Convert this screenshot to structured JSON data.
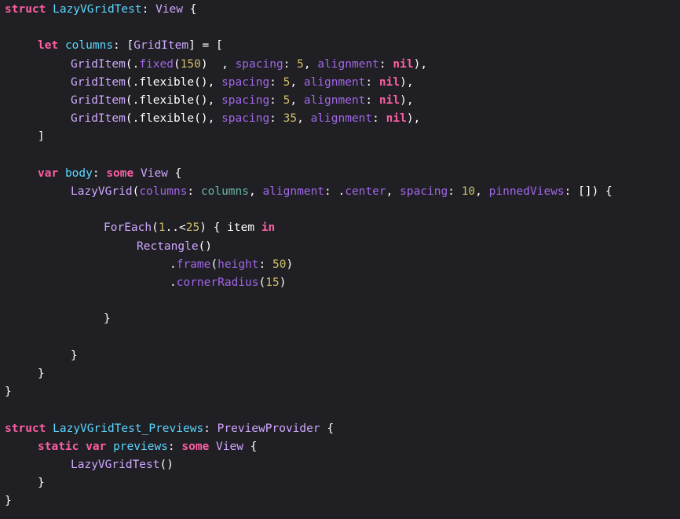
{
  "editor": {
    "language": "Swift",
    "theme": "dark",
    "background": "#1f1f24",
    "colors": {
      "keyword": "#fc5fa3",
      "type_declaration": "#5dd8ff",
      "type_name": "#d0a8ff",
      "property": "#a167e6",
      "number": "#d0bf69",
      "plain": "#ffffff",
      "column_ref": "#67b7a4"
    },
    "lines": [
      {
        "indent": 0,
        "tokens": [
          {
            "t": "struct",
            "c": "kw"
          },
          {
            "t": " ",
            "c": "plain"
          },
          {
            "t": "LazyVGridTest",
            "c": "typedecl"
          },
          {
            "t": ": ",
            "c": "plain"
          },
          {
            "t": "View",
            "c": "typename"
          },
          {
            "t": " {",
            "c": "plain"
          }
        ]
      },
      {
        "indent": 0,
        "tokens": []
      },
      {
        "indent": 1,
        "tokens": [
          {
            "t": "let",
            "c": "kw"
          },
          {
            "t": " ",
            "c": "plain"
          },
          {
            "t": "columns",
            "c": "typedecl"
          },
          {
            "t": ": [",
            "c": "plain"
          },
          {
            "t": "GridItem",
            "c": "typename"
          },
          {
            "t": "] = [",
            "c": "plain"
          }
        ]
      },
      {
        "indent": 2,
        "tokens": [
          {
            "t": "GridItem",
            "c": "typename"
          },
          {
            "t": "(.",
            "c": "plain"
          },
          {
            "t": "fixed",
            "c": "prop"
          },
          {
            "t": "(",
            "c": "plain"
          },
          {
            "t": "150",
            "c": "num"
          },
          {
            "t": ")  , ",
            "c": "plain"
          },
          {
            "t": "spacing",
            "c": "prop"
          },
          {
            "t": ": ",
            "c": "plain"
          },
          {
            "t": "5",
            "c": "num"
          },
          {
            "t": ", ",
            "c": "plain"
          },
          {
            "t": "alignment",
            "c": "prop"
          },
          {
            "t": ": ",
            "c": "plain"
          },
          {
            "t": "nil",
            "c": "kw"
          },
          {
            "t": "),",
            "c": "plain"
          }
        ]
      },
      {
        "indent": 2,
        "tokens": [
          {
            "t": "GridItem",
            "c": "typename"
          },
          {
            "t": "(.flexible(), ",
            "c": "plain"
          },
          {
            "t": "spacing",
            "c": "prop"
          },
          {
            "t": ": ",
            "c": "plain"
          },
          {
            "t": "5",
            "c": "num"
          },
          {
            "t": ", ",
            "c": "plain"
          },
          {
            "t": "alignment",
            "c": "prop"
          },
          {
            "t": ": ",
            "c": "plain"
          },
          {
            "t": "nil",
            "c": "kw"
          },
          {
            "t": "),",
            "c": "plain"
          }
        ]
      },
      {
        "indent": 2,
        "tokens": [
          {
            "t": "GridItem",
            "c": "typename"
          },
          {
            "t": "(.flexible(), ",
            "c": "plain"
          },
          {
            "t": "spacing",
            "c": "prop"
          },
          {
            "t": ": ",
            "c": "plain"
          },
          {
            "t": "5",
            "c": "num"
          },
          {
            "t": ", ",
            "c": "plain"
          },
          {
            "t": "alignment",
            "c": "prop"
          },
          {
            "t": ": ",
            "c": "plain"
          },
          {
            "t": "nil",
            "c": "kw"
          },
          {
            "t": "),",
            "c": "plain"
          }
        ]
      },
      {
        "indent": 2,
        "tokens": [
          {
            "t": "GridItem",
            "c": "typename"
          },
          {
            "t": "(.flexible(), ",
            "c": "plain"
          },
          {
            "t": "spacing",
            "c": "prop"
          },
          {
            "t": ": ",
            "c": "plain"
          },
          {
            "t": "35",
            "c": "num"
          },
          {
            "t": ", ",
            "c": "plain"
          },
          {
            "t": "alignment",
            "c": "prop"
          },
          {
            "t": ": ",
            "c": "plain"
          },
          {
            "t": "nil",
            "c": "kw"
          },
          {
            "t": "),",
            "c": "plain"
          }
        ]
      },
      {
        "indent": 1,
        "tokens": [
          {
            "t": "]",
            "c": "plain"
          }
        ]
      },
      {
        "indent": 0,
        "tokens": []
      },
      {
        "indent": 1,
        "tokens": [
          {
            "t": "var",
            "c": "kw"
          },
          {
            "t": " ",
            "c": "plain"
          },
          {
            "t": "body",
            "c": "typedecl"
          },
          {
            "t": ": ",
            "c": "plain"
          },
          {
            "t": "some",
            "c": "kw"
          },
          {
            "t": " ",
            "c": "plain"
          },
          {
            "t": "View",
            "c": "typename"
          },
          {
            "t": " {",
            "c": "plain"
          }
        ]
      },
      {
        "indent": 2,
        "tokens": [
          {
            "t": "LazyVGrid",
            "c": "typename"
          },
          {
            "t": "(",
            "c": "plain"
          },
          {
            "t": "columns",
            "c": "prop"
          },
          {
            "t": ": ",
            "c": "plain"
          },
          {
            "t": "columns",
            "c": "col"
          },
          {
            "t": ", ",
            "c": "plain"
          },
          {
            "t": "alignment",
            "c": "prop"
          },
          {
            "t": ": .",
            "c": "plain"
          },
          {
            "t": "center",
            "c": "prop"
          },
          {
            "t": ", ",
            "c": "plain"
          },
          {
            "t": "spacing",
            "c": "prop"
          },
          {
            "t": ": ",
            "c": "plain"
          },
          {
            "t": "10",
            "c": "num"
          },
          {
            "t": ", ",
            "c": "plain"
          },
          {
            "t": "pinnedViews",
            "c": "prop"
          },
          {
            "t": ": []) {",
            "c": "plain"
          }
        ]
      },
      {
        "indent": 0,
        "tokens": []
      },
      {
        "indent": 3,
        "tokens": [
          {
            "t": "ForEach",
            "c": "typename"
          },
          {
            "t": "(",
            "c": "plain"
          },
          {
            "t": "1",
            "c": "num"
          },
          {
            "t": "..<",
            "c": "plain"
          },
          {
            "t": "25",
            "c": "num"
          },
          {
            "t": ") { item ",
            "c": "plain"
          },
          {
            "t": "in",
            "c": "kw"
          }
        ]
      },
      {
        "indent": 4,
        "tokens": [
          {
            "t": "Rectangle",
            "c": "typename"
          },
          {
            "t": "()",
            "c": "plain"
          }
        ]
      },
      {
        "indent": 5,
        "tokens": [
          {
            "t": ".",
            "c": "plain"
          },
          {
            "t": "frame",
            "c": "prop"
          },
          {
            "t": "(",
            "c": "plain"
          },
          {
            "t": "height",
            "c": "prop"
          },
          {
            "t": ": ",
            "c": "plain"
          },
          {
            "t": "50",
            "c": "num"
          },
          {
            "t": ")",
            "c": "plain"
          }
        ]
      },
      {
        "indent": 5,
        "tokens": [
          {
            "t": ".",
            "c": "plain"
          },
          {
            "t": "cornerRadius",
            "c": "prop"
          },
          {
            "t": "(",
            "c": "plain"
          },
          {
            "t": "15",
            "c": "num"
          },
          {
            "t": ")",
            "c": "plain"
          }
        ]
      },
      {
        "indent": 0,
        "tokens": []
      },
      {
        "indent": 3,
        "tokens": [
          {
            "t": "}",
            "c": "plain"
          }
        ]
      },
      {
        "indent": 0,
        "tokens": []
      },
      {
        "indent": 2,
        "tokens": [
          {
            "t": "}",
            "c": "plain"
          }
        ]
      },
      {
        "indent": 1,
        "tokens": [
          {
            "t": "}",
            "c": "plain"
          }
        ]
      },
      {
        "indent": 0,
        "tokens": [
          {
            "t": "}",
            "c": "plain"
          }
        ]
      },
      {
        "indent": 0,
        "tokens": []
      },
      {
        "indent": 0,
        "tokens": [
          {
            "t": "struct",
            "c": "kw"
          },
          {
            "t": " ",
            "c": "plain"
          },
          {
            "t": "LazyVGridTest_Previews",
            "c": "typedecl"
          },
          {
            "t": ": ",
            "c": "plain"
          },
          {
            "t": "PreviewProvider",
            "c": "typename"
          },
          {
            "t": " {",
            "c": "plain"
          }
        ]
      },
      {
        "indent": 1,
        "tokens": [
          {
            "t": "static",
            "c": "kw"
          },
          {
            "t": " ",
            "c": "plain"
          },
          {
            "t": "var",
            "c": "kw"
          },
          {
            "t": " ",
            "c": "plain"
          },
          {
            "t": "previews",
            "c": "typedecl"
          },
          {
            "t": ": ",
            "c": "plain"
          },
          {
            "t": "some",
            "c": "kw"
          },
          {
            "t": " ",
            "c": "plain"
          },
          {
            "t": "View",
            "c": "typename"
          },
          {
            "t": " {",
            "c": "plain"
          }
        ]
      },
      {
        "indent": 2,
        "tokens": [
          {
            "t": "LazyVGridTest",
            "c": "typename"
          },
          {
            "t": "()",
            "c": "plain"
          }
        ]
      },
      {
        "indent": 1,
        "tokens": [
          {
            "t": "}",
            "c": "plain"
          }
        ]
      },
      {
        "indent": 0,
        "tokens": [
          {
            "t": "}",
            "c": "plain"
          }
        ]
      }
    ]
  }
}
